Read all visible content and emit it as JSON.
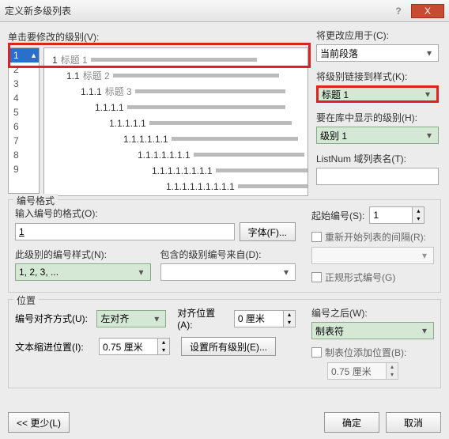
{
  "title": "定义新多级列表",
  "winbuttons": {
    "help": "?",
    "close": "X"
  },
  "left": {
    "clickLevelLabel": "单击要修改的级别(V):",
    "levels": [
      "1",
      "2",
      "3",
      "4",
      "5",
      "6",
      "7",
      "8",
      "9"
    ],
    "previewLines": [
      {
        "indent": 10,
        "num": "1",
        "txt": "标题 1",
        "bar": 210
      },
      {
        "indent": 28,
        "num": "1.1",
        "txt": "标题 2",
        "bar": 210
      },
      {
        "indent": 46,
        "num": "1.1.1",
        "txt": "标题 3",
        "bar": 190
      },
      {
        "indent": 64,
        "num": "1.1.1.1",
        "txt": "",
        "bar": 200
      },
      {
        "indent": 82,
        "num": "1.1.1.1.1",
        "txt": "",
        "bar": 180
      },
      {
        "indent": 100,
        "num": "1.1.1.1.1.1",
        "txt": "",
        "bar": 160
      },
      {
        "indent": 118,
        "num": "1.1.1.1.1.1.1",
        "txt": "",
        "bar": 140
      },
      {
        "indent": 136,
        "num": "1.1.1.1.1.1.1.1",
        "txt": "",
        "bar": 120
      },
      {
        "indent": 154,
        "num": "1.1.1.1.1.1.1.1.1",
        "txt": "",
        "bar": 100
      }
    ]
  },
  "right": {
    "applyLabel": "将更改应用于(C):",
    "applyValue": "当前段落",
    "linkStyleLabel": "将级别链接到样式(K):",
    "linkStyleValue": "标题 1",
    "galleryLabel": "要在库中显示的级别(H):",
    "galleryValue": "级别 1",
    "listnumLabel": "ListNum 域列表名(T):"
  },
  "format": {
    "groupTitle": "编号格式",
    "numberFormatLabel": "输入编号的格式(O):",
    "numberFormatValue": "1",
    "fontBtn": "字体(F)...",
    "styleLabel": "此级别的编号样式(N):",
    "styleValue": "1, 2, 3, ...",
    "includeLabel": "包含的级别编号来自(D):",
    "startLabel": "起始编号(S):",
    "startValue": "1",
    "restartLabel": "重新开始列表的间隔(R):",
    "legalLabel": "正规形式编号(G)"
  },
  "position": {
    "groupTitle": "位置",
    "alignLabel": "编号对齐方式(U):",
    "alignValue": "左对齐",
    "alignAtLabel": "对齐位置(A):",
    "alignAtValue": "0 厘米",
    "indentLabel": "文本缩进位置(I):",
    "indentValue": "0.75 厘米",
    "setAllBtn": "设置所有级别(E)...",
    "followLabel": "编号之后(W):",
    "followValue": "制表符",
    "tabAddLabel": "制表位添加位置(B):",
    "tabAddValue": "0.75 厘米"
  },
  "bottom": {
    "less": "<< 更少(L)",
    "ok": "确定",
    "cancel": "取消"
  }
}
